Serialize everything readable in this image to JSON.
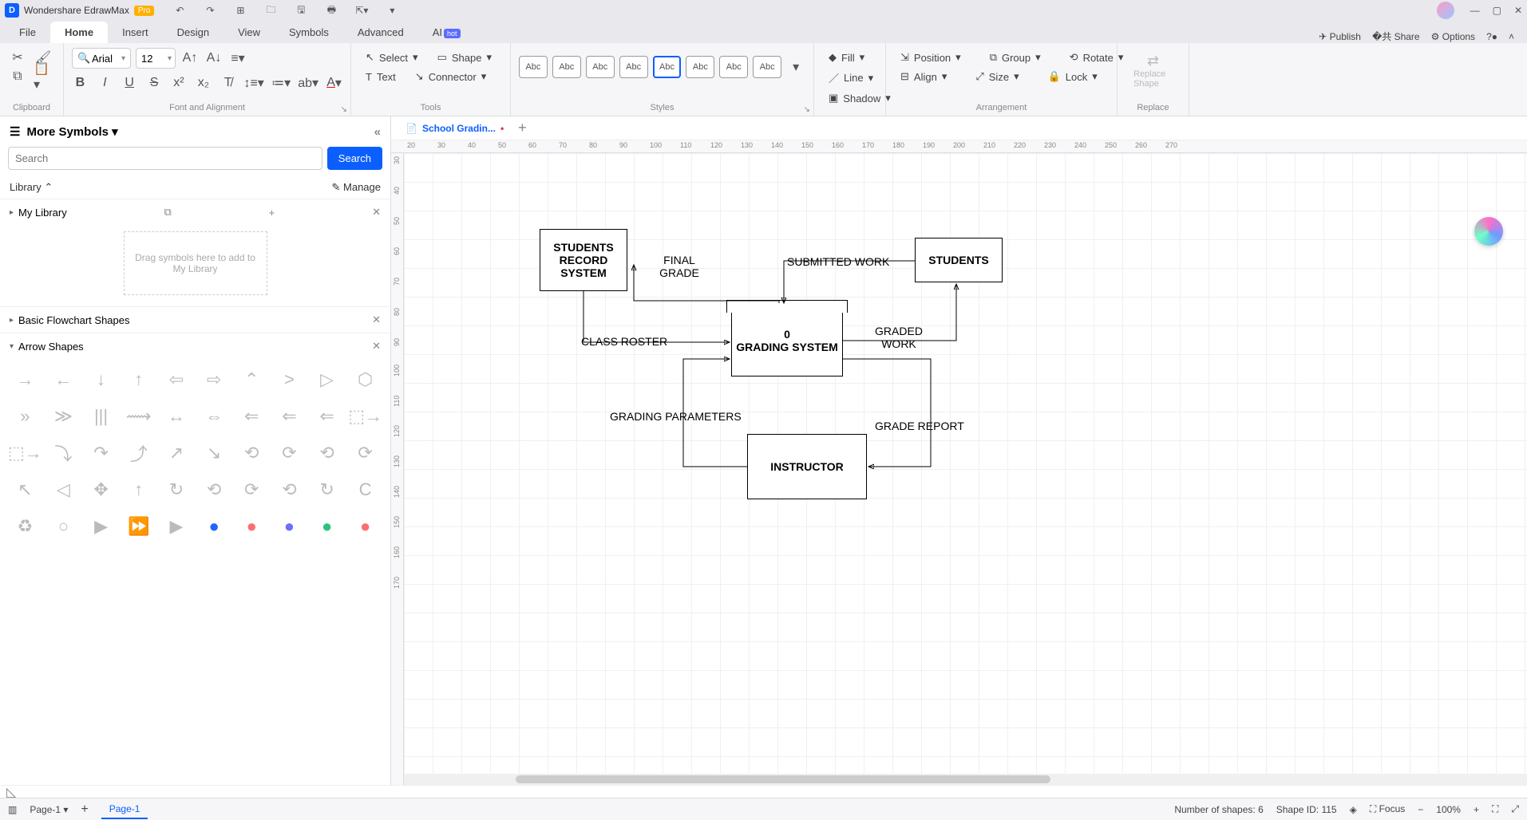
{
  "app": {
    "title": "Wondershare EdrawMax",
    "badge": "Pro"
  },
  "menus": [
    "File",
    "Home",
    "Insert",
    "Design",
    "View",
    "Symbols",
    "Advanced",
    "AI"
  ],
  "menu_active": 1,
  "ai_hot": "hot",
  "top_right": {
    "publish": "Publish",
    "share": "Share",
    "options": "Options"
  },
  "ribbon": {
    "clipboard": "Clipboard",
    "font_align": "Font and Alignment",
    "tools": "Tools",
    "styles": "Styles",
    "arrangement": "Arrangement",
    "replace": "Replace",
    "font_name": "Arial",
    "font_size": "12",
    "select": "Select",
    "shape": "Shape",
    "text": "Text",
    "connector": "Connector",
    "fill": "Fill",
    "line": "Line",
    "shadow": "Shadow",
    "position": "Position",
    "align": "Align",
    "group": "Group",
    "size": "Size",
    "rotate": "Rotate",
    "lock": "Lock",
    "replace_shape": "Replace Shape",
    "style_label": "Abc"
  },
  "left": {
    "title": "More Symbols",
    "search_placeholder": "Search",
    "search_btn": "Search",
    "library": "Library",
    "manage": "Manage",
    "my_library": "My Library",
    "drop_hint": "Drag symbols here to add to My Library",
    "basic_flowchart": "Basic Flowchart Shapes",
    "arrow_shapes": "Arrow Shapes"
  },
  "doc": {
    "tab_name": "School Gradin...",
    "unsaved": "•",
    "add_tab": "+"
  },
  "diagram": {
    "shapes": {
      "students_record": "STUDENTS RECORD SYSTEM",
      "students": "STUDENTS",
      "grading_system_top": "0",
      "grading_system_mid": "GRADING SYSTEM",
      "instructor": "INSTRUCTOR"
    },
    "labels": {
      "final_grade": "FINAL GRADE",
      "submitted_work": "SUBMITTED WORK",
      "class_roster": "CLASS ROSTER",
      "graded_work": "GRADED WORK",
      "grading_parameters": "GRADING PARAMETERS",
      "grade_report": "GRADE REPORT"
    }
  },
  "ruler_h": [
    "20",
    "30",
    "40",
    "50",
    "60",
    "70",
    "80",
    "90",
    "100",
    "110",
    "120",
    "130",
    "140",
    "150",
    "160",
    "170",
    "180",
    "190",
    "200",
    "210",
    "220",
    "230",
    "240",
    "250",
    "260",
    "270"
  ],
  "ruler_v": [
    "30",
    "40",
    "50",
    "60",
    "70",
    "80",
    "90",
    "100",
    "110",
    "120",
    "130",
    "140",
    "150",
    "160",
    "170"
  ],
  "status": {
    "page_select": "Page-1",
    "page_tab": "Page-1",
    "shapes_count": "Number of shapes: 6",
    "shape_id": "Shape ID: 115",
    "focus": "Focus",
    "zoom": "100%"
  },
  "colors": [
    "#ffffff",
    "#8b0000",
    "#b22222",
    "#dc143c",
    "#ff0000",
    "#cd5c5c",
    "#f08080",
    "#fa8072",
    "#2f4f4f",
    "#008080",
    "#20b2aa",
    "#5f9ea0",
    "#66cdaa",
    "#7fffd4",
    "#ff8c00",
    "#ffa500",
    "#ff7f50",
    "#ffa07a",
    "#ffdab9",
    "#006400",
    "#228b22",
    "#2e8b57",
    "#3cb371",
    "#8fbc8f",
    "#98fb98",
    "#4b0082",
    "#8a2be2",
    "#9370db",
    "#ba55d3",
    "#da70d6",
    "#ee82ee",
    "#556b2f",
    "#6b8e23",
    "#9acd32",
    "#adff2f",
    "#00008b",
    "#0000cd",
    "#4169e1",
    "#1e90ff",
    "#6495ed",
    "#87cefa",
    "#483d8b",
    "#6a5acd",
    "#7b68ee",
    "#9370db",
    "#228b22",
    "#32cd32",
    "#90ee90",
    "#8b4513",
    "#a0522d",
    "#cd853f",
    "#d2691e",
    "#f4a460",
    "#00bfff",
    "#87ceeb",
    "#add8e6",
    "#b0e0e6",
    "#8b4513",
    "#a52a2a",
    "#bc8f8f",
    "#d2b48c",
    "#f5deb3",
    "#708090",
    "#778899",
    "#b0c4de",
    "#2f2f2f",
    "#4f4f4f",
    "#6f6f6f",
    "#8f8f8f",
    "#afafaf",
    "#cfcfcf"
  ]
}
